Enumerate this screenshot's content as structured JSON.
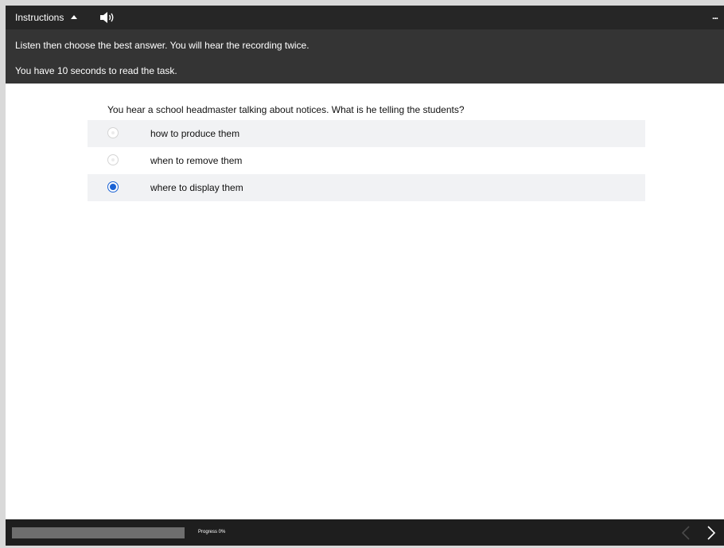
{
  "header": {
    "instructions_label": "Instructions",
    "speaker_icon": "speaker-icon",
    "more_label": "..."
  },
  "instructions": {
    "line1": "Listen then choose the best answer. You will hear the recording twice.",
    "line2": "You have 10 seconds to read the task."
  },
  "question": {
    "text": "You hear a school headmaster talking about notices. What is he telling the students?",
    "options": [
      {
        "label": "how to produce them",
        "selected": false
      },
      {
        "label": "when to remove them",
        "selected": false
      },
      {
        "label": "where to display them",
        "selected": true
      }
    ]
  },
  "footer": {
    "progress_label": "Progress 0%",
    "progress_value": 0,
    "prev_icon": "chevron-left-icon",
    "next_icon": "chevron-right-icon"
  },
  "colors": {
    "topbar": "#343434",
    "accent": "#1a62d4",
    "footer": "#1e1e1e"
  }
}
